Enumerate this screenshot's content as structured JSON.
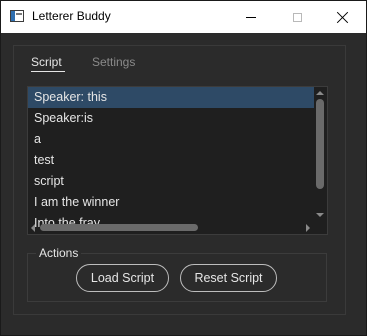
{
  "window": {
    "title": "Letterer Buddy",
    "icon": "app-window-icon",
    "controls": [
      "minimize-icon",
      "maximize-icon",
      "close-icon"
    ]
  },
  "tabs": [
    {
      "label": "Script",
      "active": true
    },
    {
      "label": "Settings",
      "active": false
    }
  ],
  "script_lines": [
    "Speaker: this",
    "Speaker:is",
    "a",
    "test",
    "script",
    "I am the winner",
    "Into the fray"
  ],
  "selected_index": 0,
  "actions": {
    "title": "Actions",
    "load_label": "Load Script",
    "reset_label": "Reset Script"
  },
  "colors": {
    "window_bg": "#2b2b2b",
    "list_bg": "#1f1f1f",
    "selection": "#2e4a66",
    "text": "#e6e6e6"
  }
}
